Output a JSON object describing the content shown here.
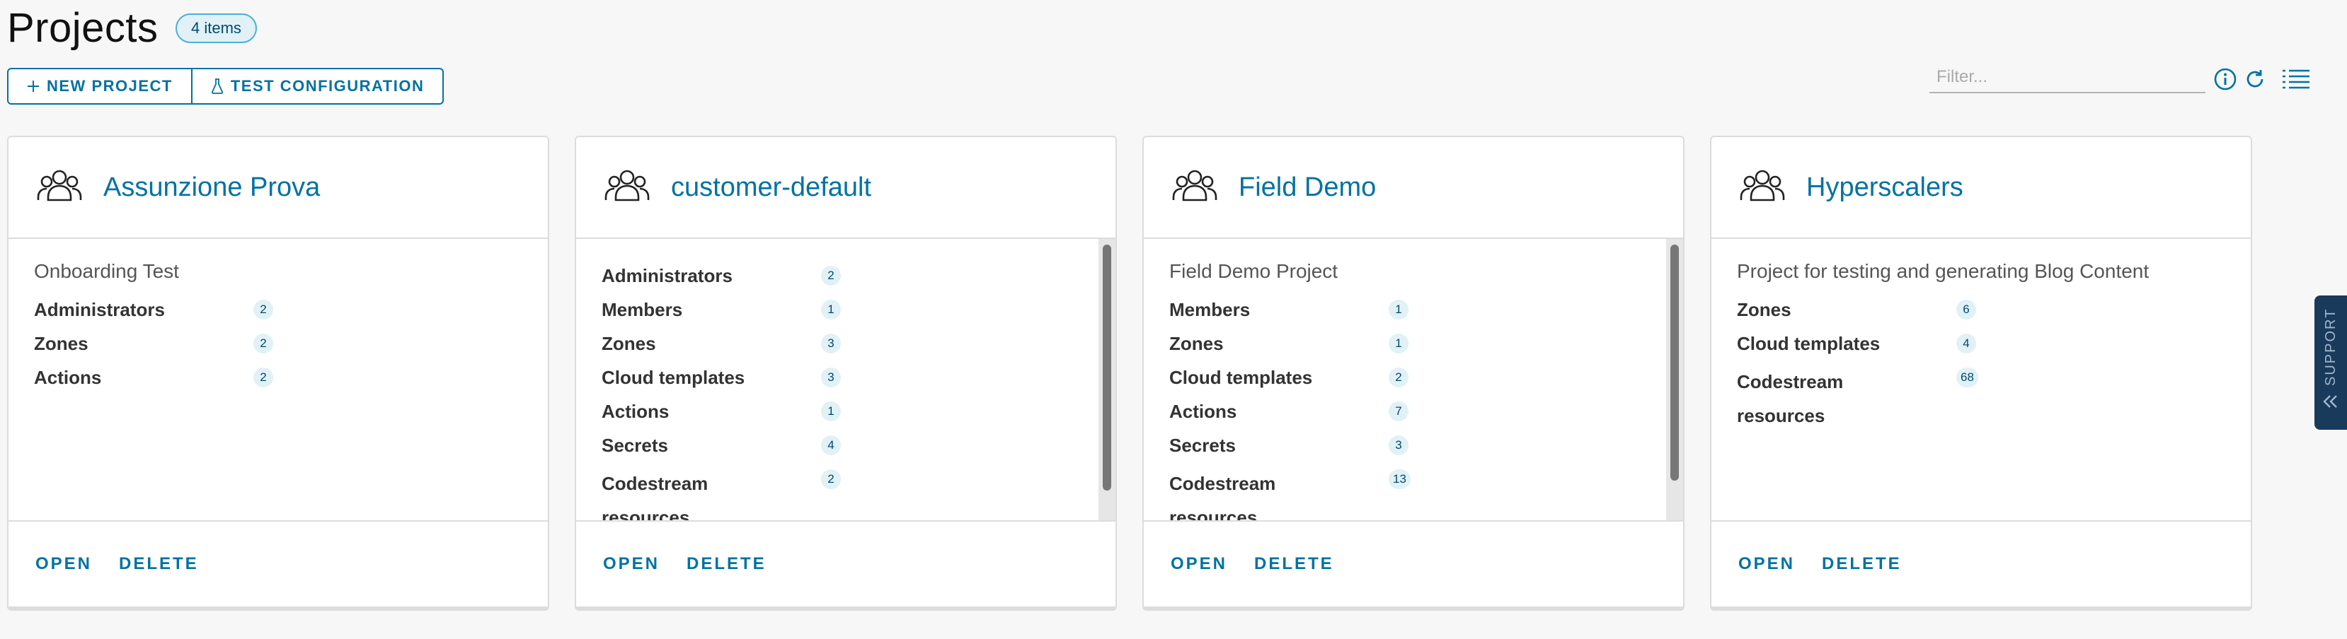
{
  "header": {
    "title": "Projects",
    "count_badge": "4 items"
  },
  "toolbar": {
    "new_project_label": "NEW PROJECT",
    "test_configuration_label": "TEST CONFIGURATION"
  },
  "filter": {
    "placeholder": "Filter..."
  },
  "tools": {
    "info_icon": "info-icon",
    "refresh_icon": "refresh-icon",
    "list_view_icon": "list-view-icon"
  },
  "cards": [
    {
      "title": "Assunzione Prova",
      "description": "Onboarding Test",
      "stats": [
        {
          "label": "Administrators",
          "count": "2"
        },
        {
          "label": "Zones",
          "count": "2"
        },
        {
          "label": "Actions",
          "count": "2"
        }
      ],
      "open_label": "OPEN",
      "delete_label": "DELETE"
    },
    {
      "title": "customer-default",
      "description": "",
      "stats": [
        {
          "label": "Administrators",
          "count": "2"
        },
        {
          "label": "Members",
          "count": "1"
        },
        {
          "label": "Zones",
          "count": "3"
        },
        {
          "label": "Cloud templates",
          "count": "3"
        },
        {
          "label": "Actions",
          "count": "1"
        },
        {
          "label": "Secrets",
          "count": "4"
        },
        {
          "label": "Codestream resources",
          "count": "2"
        }
      ],
      "open_label": "OPEN",
      "delete_label": "DELETE"
    },
    {
      "title": "Field Demo",
      "description": "Field Demo Project",
      "stats": [
        {
          "label": "Members",
          "count": "1"
        },
        {
          "label": "Zones",
          "count": "1"
        },
        {
          "label": "Cloud templates",
          "count": "2"
        },
        {
          "label": "Actions",
          "count": "7"
        },
        {
          "label": "Secrets",
          "count": "3"
        },
        {
          "label": "Codestream resources",
          "count": "13"
        }
      ],
      "open_label": "OPEN",
      "delete_label": "DELETE"
    },
    {
      "title": "Hyperscalers",
      "description": "Project for testing and generating Blog Content",
      "stats": [
        {
          "label": "Zones",
          "count": "6"
        },
        {
          "label": "Cloud templates",
          "count": "4"
        },
        {
          "label": "Codestream resources",
          "count": "68"
        }
      ],
      "open_label": "OPEN",
      "delete_label": "DELETE"
    }
  ],
  "support": {
    "label": "SUPPORT"
  },
  "colors": {
    "accent": "#0072a3",
    "badge_bg": "#e1f1f6",
    "support_bg": "#1a3a5c"
  }
}
